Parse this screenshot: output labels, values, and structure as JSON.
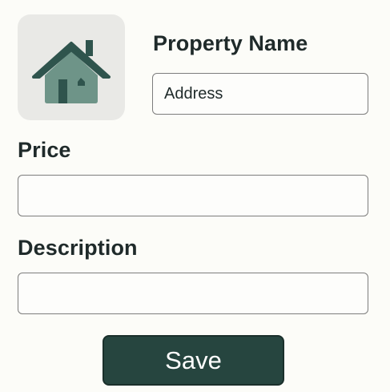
{
  "form": {
    "property_name_label": "Property Name",
    "address_value": "Address",
    "price_label": "Price",
    "price_value": "",
    "description_label": "Description",
    "description_value": "",
    "save_label": "Save"
  },
  "icons": {
    "property_image": "house-icon"
  },
  "colors": {
    "accent": "#26453f",
    "house_roof": "#2f544d",
    "house_body": "#6e9488",
    "thumb_background": "#e9e9e6"
  }
}
